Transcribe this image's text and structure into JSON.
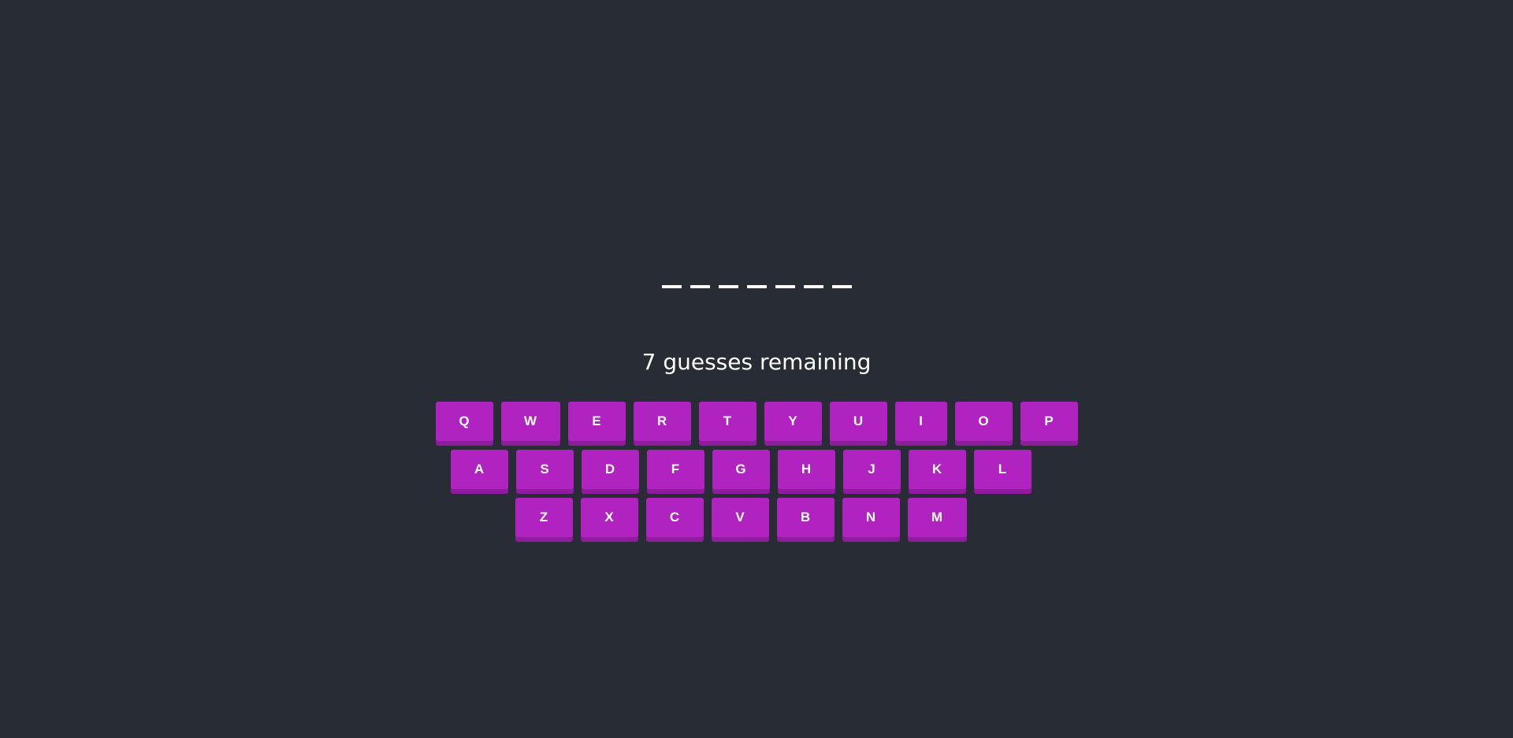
{
  "word": {
    "letters": [
      "",
      "",
      "",
      "",
      "",
      "",
      ""
    ]
  },
  "status": {
    "text": "7 guesses remaining"
  },
  "keyboard": {
    "rows": [
      [
        "Q",
        "W",
        "E",
        "R",
        "T",
        "Y",
        "U",
        "I",
        "O",
        "P"
      ],
      [
        "A",
        "S",
        "D",
        "F",
        "G",
        "H",
        "J",
        "K",
        "L"
      ],
      [
        "Z",
        "X",
        "C",
        "V",
        "B",
        "N",
        "M"
      ]
    ]
  },
  "colors": {
    "background": "#282c34",
    "key": "#b023c0",
    "key_shadow": "#8e1c9c",
    "text": "#ffffff"
  }
}
